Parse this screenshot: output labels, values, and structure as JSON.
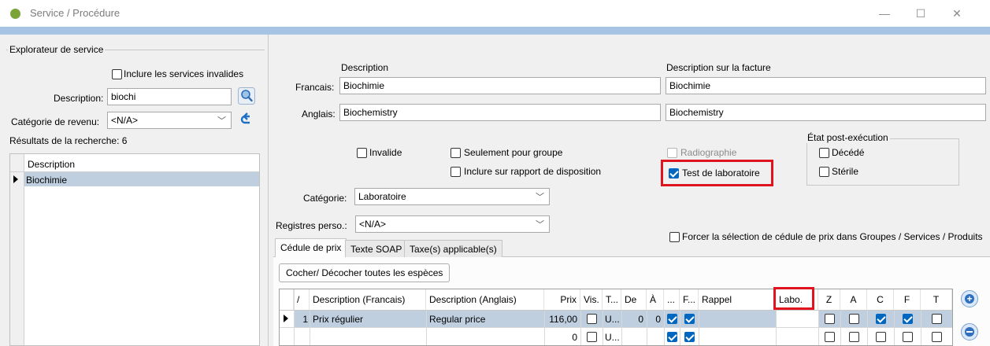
{
  "window": {
    "title": "Service / Procédure",
    "minimize": "—",
    "maximize": "☐",
    "close": "✕"
  },
  "explorer": {
    "legend": "Explorateur de service",
    "include_invalid": "Inclure les services invalides",
    "description_label": "Description:",
    "description_value": "biochi",
    "category_label": "Catégorie de revenu:",
    "category_value": "<N/A>",
    "results_label": "Résultats de la recherche: 6",
    "grid_header": "Description",
    "grid_rows": [
      "Biochimie"
    ]
  },
  "form": {
    "description_header": "Description",
    "invoice_header": "Description sur la facture",
    "french_label": "Francais:",
    "french_value": "Biochimie",
    "french_invoice": "Biochimie",
    "english_label": "Anglais:",
    "english_value": "Biochemistry",
    "english_invoice": "Biochemistry",
    "invalid": "Invalide",
    "group_only": "Seulement pour groupe",
    "include_report": "Inclure sur rapport de disposition",
    "radiography": "Radiographie",
    "lab_test": "Test de laboratoire",
    "post_state_legend": "État post-exécution",
    "deceased": "Décédé",
    "sterile": "Stérile",
    "category_label": "Catégorie:",
    "category_value": "Laboratoire",
    "registers_label": "Registres perso.:",
    "registers_value": "<N/A>",
    "force_price": "Forcer la sélection de cédule de prix dans Groupes / Services / Produits"
  },
  "tabs": [
    "Cédule de prix",
    "Texte SOAP",
    "Taxe(s) applicable(s)"
  ],
  "price": {
    "toggle_button": "Cocher/ Décocher toutes les espèces",
    "headers": [
      "/",
      "Description (Francais)",
      "Description (Anglais)",
      "Prix",
      "Vis.",
      "T...",
      "De",
      "À",
      "...",
      "F...",
      "Rappel",
      "Labo.",
      "Z",
      "A",
      "C",
      "F",
      "T"
    ],
    "row1": {
      "num": "1",
      "fr": "Prix régulier",
      "en": "Regular price",
      "price": "116,00",
      "t": "U...",
      "de": "0",
      "a": "0"
    },
    "row2": {
      "price": "0",
      "t": "U..."
    }
  },
  "colors": {
    "accent": "#0067c0",
    "highlight": "#e0141e",
    "selection": "#bfcfe0"
  }
}
